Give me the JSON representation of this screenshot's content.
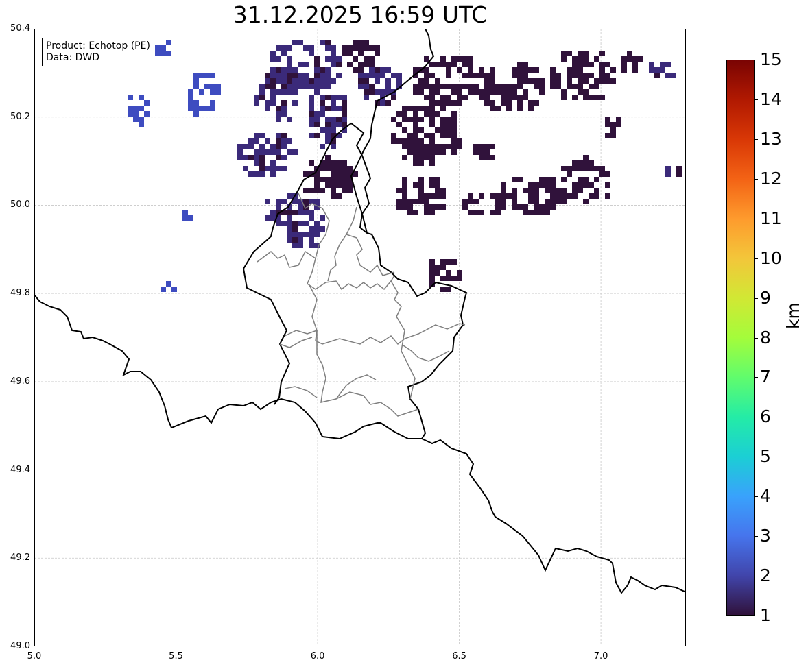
{
  "title": "31.12.2025 16:59 UTC",
  "info": {
    "product": "Product: Echotop (PE)",
    "data": "Data: DWD"
  },
  "axes": {
    "lon_range": [
      5.0,
      7.3
    ],
    "lat_range": [
      49.0,
      50.4
    ],
    "x_ticks": [
      "5.0",
      "5.5",
      "6.0",
      "6.5",
      "7.0"
    ],
    "x_tick_values": [
      5.0,
      5.5,
      6.0,
      6.5,
      7.0
    ],
    "y_ticks": [
      "49.0",
      "49.2",
      "49.4",
      "49.6",
      "49.8",
      "50.0",
      "50.2",
      "50.4"
    ],
    "y_tick_values": [
      49.0,
      49.2,
      49.4,
      49.6,
      49.8,
      50.0,
      50.2,
      50.4
    ],
    "grid": true
  },
  "colorbar": {
    "label": "km",
    "ticks": [
      "1",
      "2",
      "3",
      "4",
      "5",
      "6",
      "7",
      "8",
      "9",
      "10",
      "11",
      "12",
      "13",
      "14",
      "15"
    ],
    "min": 1,
    "max": 15,
    "colormap": "turbo"
  },
  "echo_colors": {
    "low": "#30123b",
    "mid": "#3b2a7a",
    "high": "#3e4cc0"
  }
}
